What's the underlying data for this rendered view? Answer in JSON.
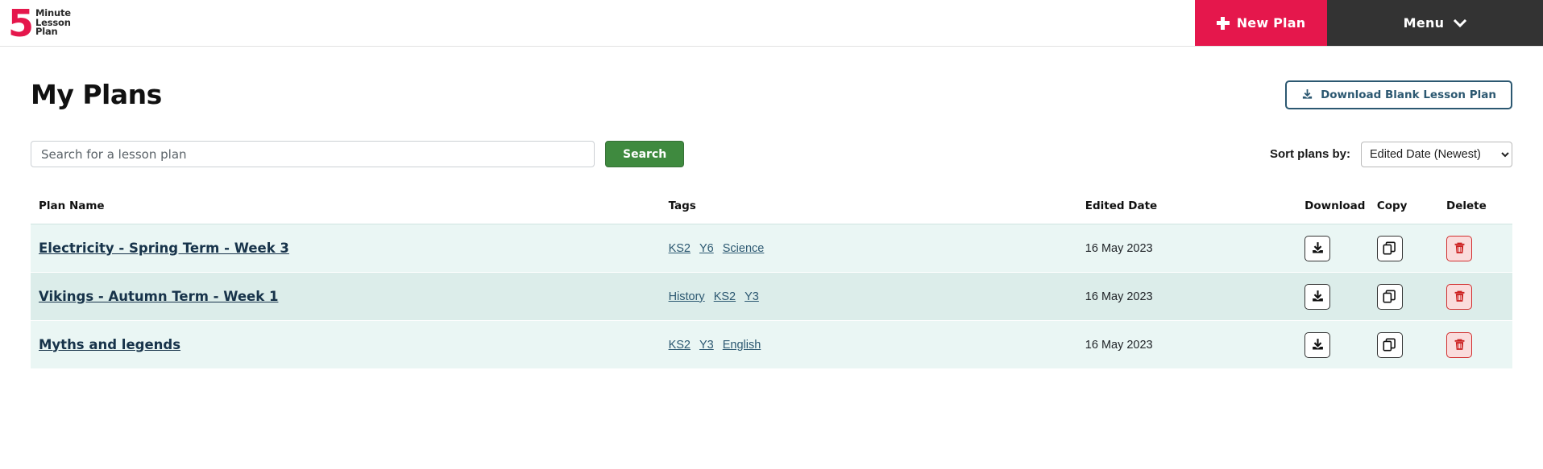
{
  "header": {
    "logo": {
      "numeral": "5",
      "line1": "Minute",
      "line2": "Lesson",
      "line3": "Plan"
    },
    "new_plan_label": "New Plan",
    "menu_label": "Menu",
    "new_plan_color": "#e5174c",
    "menu_color": "#333333"
  },
  "page": {
    "title": "My Plans",
    "download_blank_label": "Download Blank Lesson Plan"
  },
  "search": {
    "placeholder": "Search for a lesson plan",
    "value": "",
    "button_label": "Search",
    "button_color": "#3f8a3f"
  },
  "sort": {
    "label": "Sort plans by:",
    "selected": "Edited Date (Newest)",
    "options": [
      "Edited Date (Newest)"
    ]
  },
  "table": {
    "headers": {
      "name": "Plan Name",
      "tags": "Tags",
      "date": "Edited Date",
      "download": "Download",
      "copy": "Copy",
      "delete": "Delete"
    },
    "rows": [
      {
        "name": "Electricity - Spring Term - Week 3",
        "tags": [
          "KS2",
          "Y6",
          "Science"
        ],
        "date": "16 May 2023"
      },
      {
        "name": "Vikings - Autumn Term - Week 1",
        "tags": [
          "History",
          "KS2",
          "Y3"
        ],
        "date": "16 May 2023"
      },
      {
        "name": "Myths and legends",
        "tags": [
          "KS2",
          "Y3",
          "English"
        ],
        "date": "16 May 2023"
      }
    ],
    "row_bg": "#eaf6f4",
    "row_bg_alt": "#dcedea"
  }
}
